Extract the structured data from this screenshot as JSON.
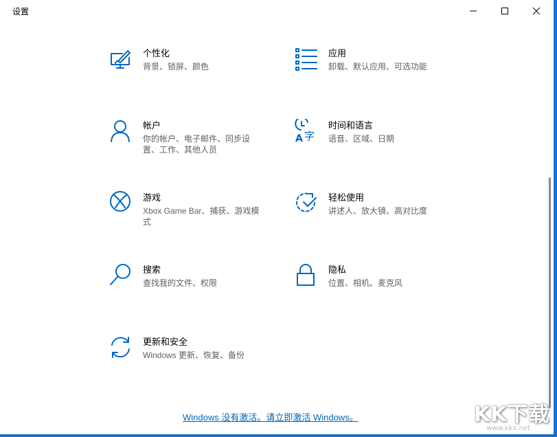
{
  "window": {
    "title": "设置"
  },
  "categories": [
    {
      "name": "个性化",
      "desc": "背景、锁屏、颜色",
      "icon": "personalization-icon"
    },
    {
      "name": "应用",
      "desc": "卸载、默认应用、可选功能",
      "icon": "apps-icon"
    },
    {
      "name": "帐户",
      "desc": "你的帐户、电子邮件、同步设置、工作、其他人员",
      "icon": "account-icon"
    },
    {
      "name": "时间和语言",
      "desc": "语音、区域、日期",
      "icon": "time-language-icon"
    },
    {
      "name": "游戏",
      "desc": "Xbox Game Bar、捕获、游戏模式",
      "icon": "xbox-icon"
    },
    {
      "name": "轻松使用",
      "desc": "讲述人、放大镜、高对比度",
      "icon": "ease-of-access-icon"
    },
    {
      "name": "搜索",
      "desc": "查找我的文件、权限",
      "icon": "search-icon"
    },
    {
      "name": "隐私",
      "desc": "位置、相机、麦克风",
      "icon": "lock-icon"
    },
    {
      "name": "更新和安全",
      "desc": "Windows 更新、恢复、备份",
      "icon": "update-icon"
    }
  ],
  "footer": {
    "activation_link": "Windows 没有激活。请立即激活 Windows。"
  },
  "watermark": {
    "logo_text": "KK下载",
    "url": "www.kkx.net"
  },
  "colors": {
    "accent": "#0067c0",
    "link": "#0067b8",
    "desktop": "#1a6fd0"
  }
}
